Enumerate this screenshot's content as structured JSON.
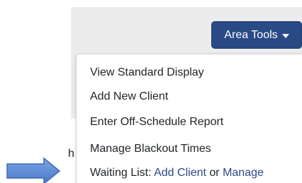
{
  "colors": {
    "button_bg": "#2a4a85",
    "button_text": "#ffffff",
    "panel_bg": "#ececec",
    "link": "#2a4a85",
    "arrow_fill": "#5b8bd6"
  },
  "toolbar": {
    "area_tools_label": "Area Tools"
  },
  "menu": {
    "items": [
      {
        "label": "View Standard Display"
      },
      {
        "label": "Add New Client"
      },
      {
        "label": "Enter Off-Schedule Report"
      },
      {
        "label": "Manage Blackout Times"
      }
    ],
    "waiting_list": {
      "prefix": "Waiting List: ",
      "add_client": "Add Client",
      "or": " or ",
      "manage": "Manage"
    }
  },
  "background": {
    "partial_text": "h"
  },
  "icons": {
    "pointer_arrow": "arrow-right-icon",
    "caret": "caret-down-icon"
  }
}
